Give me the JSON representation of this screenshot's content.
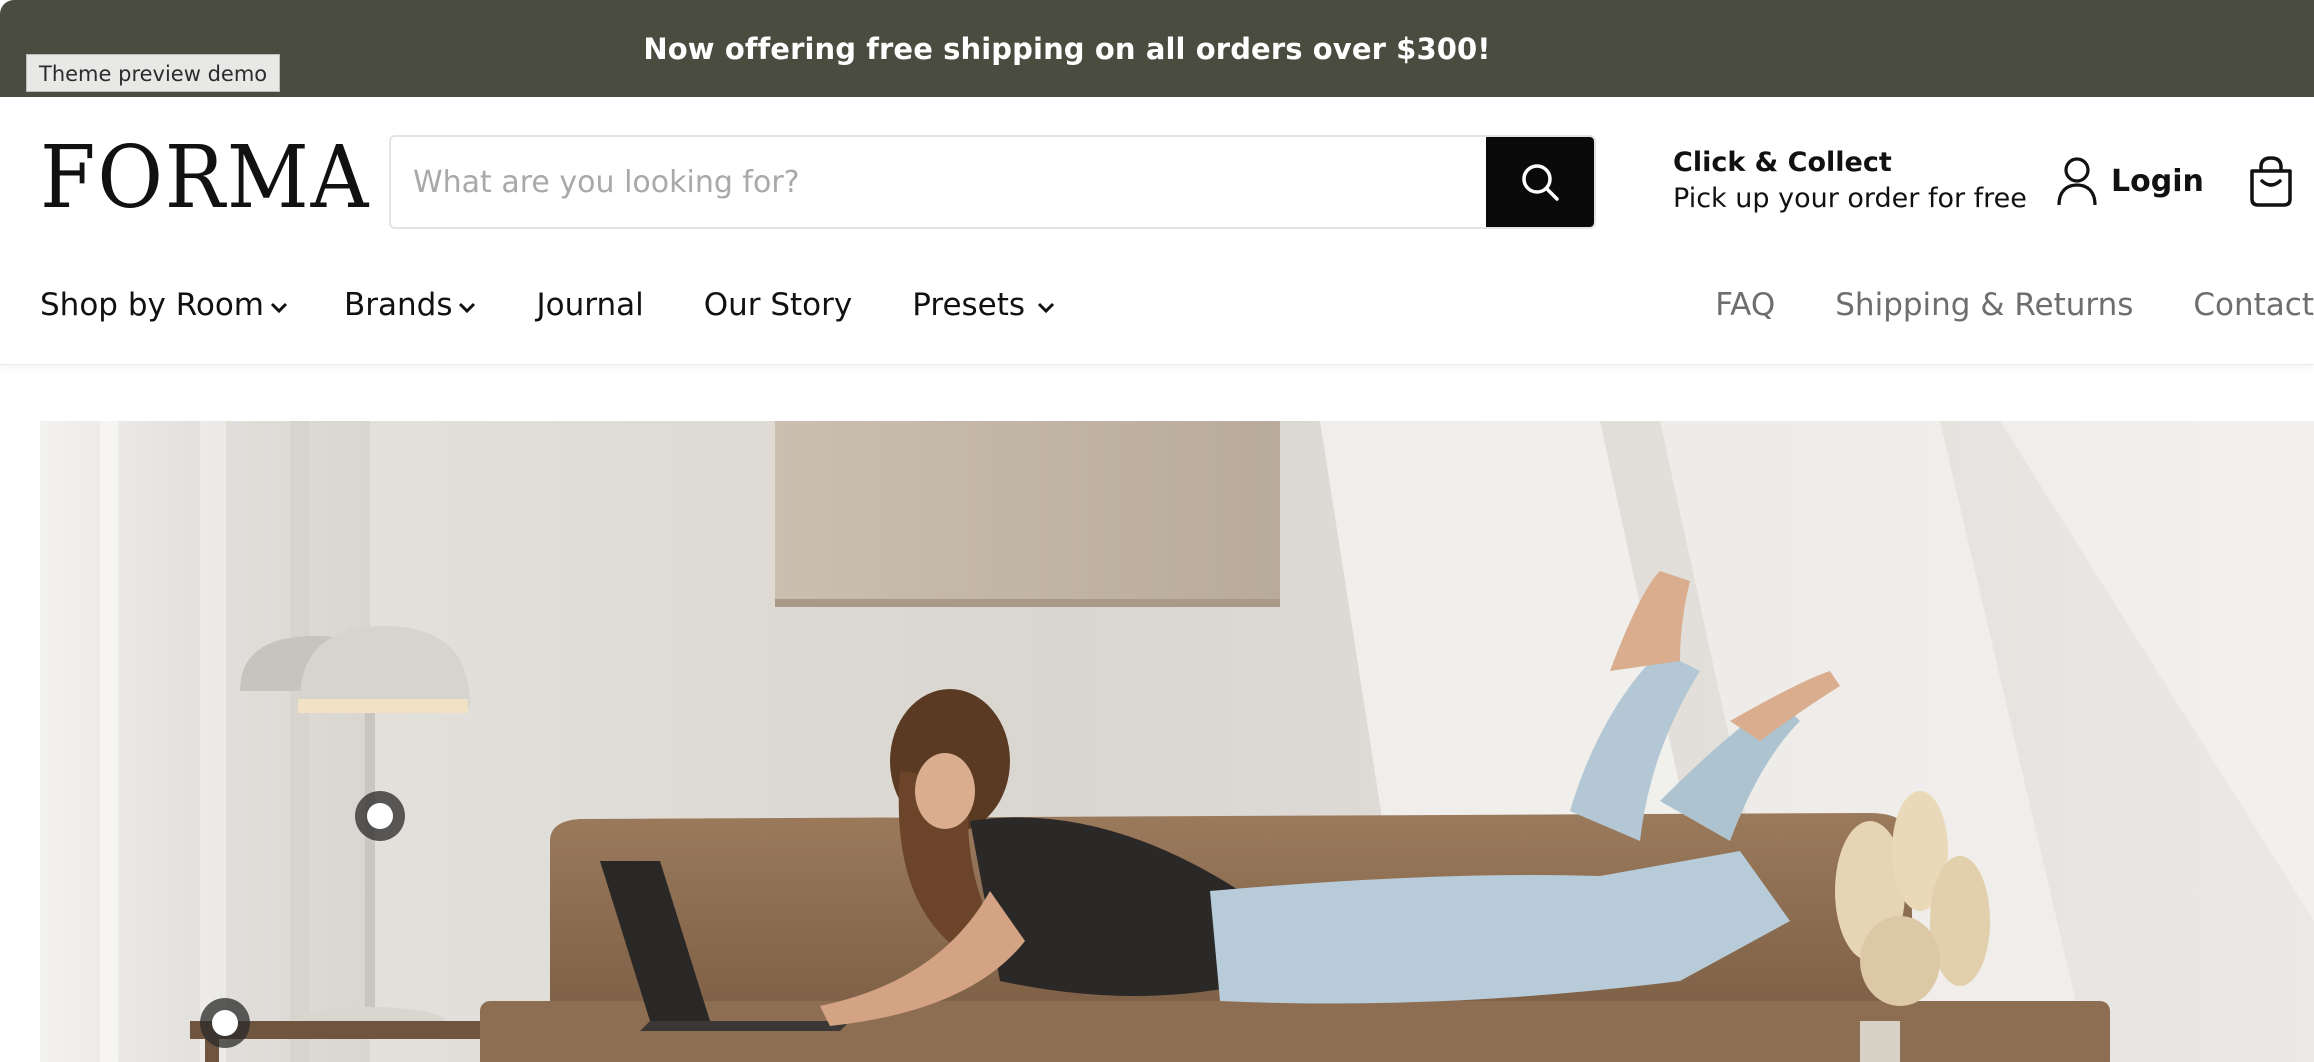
{
  "announcement": {
    "text": "Now offering free shipping on all orders over $300!"
  },
  "preview_badge": "Theme preview demo",
  "header": {
    "logo": "FORMA",
    "search": {
      "placeholder": "What are you looking for?",
      "value": ""
    },
    "click_collect": {
      "title": "Click & Collect",
      "subtitle": "Pick up your order for free"
    },
    "login_label": "Login"
  },
  "nav": {
    "left": [
      {
        "label": "Shop by Room",
        "dropdown": true
      },
      {
        "label": "Brands",
        "dropdown": true
      },
      {
        "label": "Journal",
        "dropdown": false
      },
      {
        "label": "Our Story",
        "dropdown": false
      },
      {
        "label": "Presets",
        "dropdown": true
      }
    ],
    "right": [
      "FAQ",
      "Shipping & Returns",
      "Contact"
    ]
  },
  "hero": {
    "icons": [
      "lamp-hotspot",
      "side-table-hotspot"
    ]
  },
  "colors": {
    "announcement_bg": "#4a4c40",
    "search_button_bg": "#0a0a0a",
    "nav_secondary": "#6e6e6e"
  }
}
